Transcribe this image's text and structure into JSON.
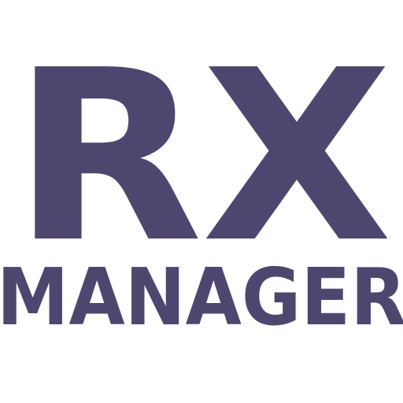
{
  "logo": {
    "primary_text": "RX",
    "secondary_text": "MANAGER"
  },
  "colors": {
    "brand_text": "#4f4670",
    "background": "#ffffff"
  }
}
